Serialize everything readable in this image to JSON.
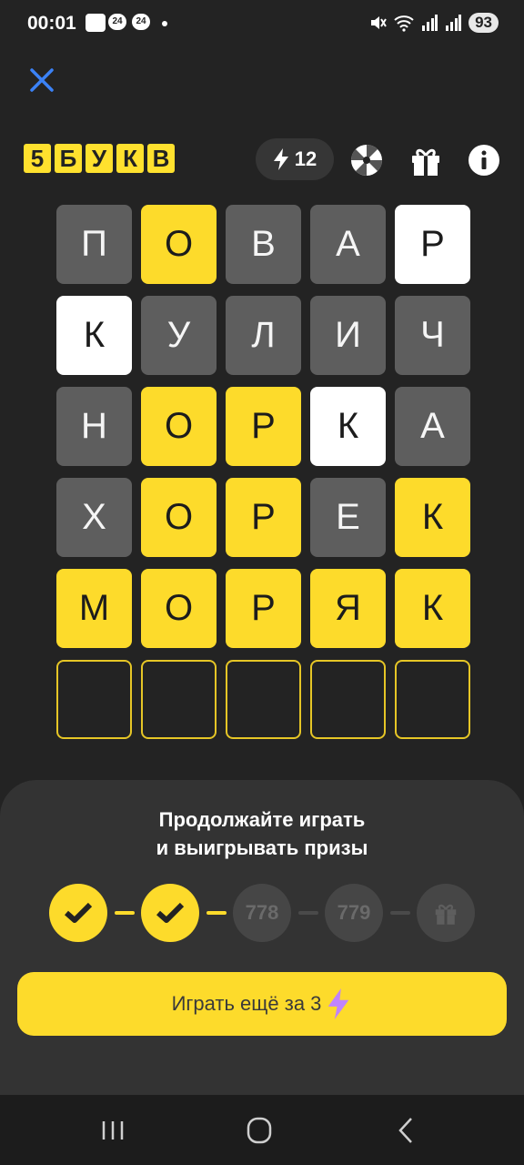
{
  "status_bar": {
    "time": "00:01",
    "notif_1": "24",
    "notif_2": "24",
    "battery": "93"
  },
  "header": {
    "logo_letters": [
      "5",
      "Б",
      "У",
      "К",
      "В"
    ],
    "energy_count": "12"
  },
  "grid": {
    "rows": [
      [
        {
          "l": "П",
          "s": "gray"
        },
        {
          "l": "О",
          "s": "yellow"
        },
        {
          "l": "В",
          "s": "gray"
        },
        {
          "l": "А",
          "s": "gray"
        },
        {
          "l": "Р",
          "s": "white"
        }
      ],
      [
        {
          "l": "К",
          "s": "white"
        },
        {
          "l": "У",
          "s": "gray"
        },
        {
          "l": "Л",
          "s": "gray"
        },
        {
          "l": "И",
          "s": "gray"
        },
        {
          "l": "Ч",
          "s": "gray"
        }
      ],
      [
        {
          "l": "Н",
          "s": "gray"
        },
        {
          "l": "О",
          "s": "yellow"
        },
        {
          "l": "Р",
          "s": "yellow"
        },
        {
          "l": "К",
          "s": "white"
        },
        {
          "l": "А",
          "s": "gray"
        }
      ],
      [
        {
          "l": "Х",
          "s": "gray"
        },
        {
          "l": "О",
          "s": "yellow"
        },
        {
          "l": "Р",
          "s": "yellow"
        },
        {
          "l": "Е",
          "s": "gray"
        },
        {
          "l": "К",
          "s": "yellow"
        }
      ],
      [
        {
          "l": "М",
          "s": "yellow"
        },
        {
          "l": "О",
          "s": "yellow"
        },
        {
          "l": "Р",
          "s": "yellow"
        },
        {
          "l": "Я",
          "s": "yellow"
        },
        {
          "l": "К",
          "s": "yellow"
        }
      ],
      [
        {
          "l": "",
          "s": "empty"
        },
        {
          "l": "",
          "s": "empty"
        },
        {
          "l": "",
          "s": "empty"
        },
        {
          "l": "",
          "s": "empty"
        },
        {
          "l": "",
          "s": "empty"
        }
      ]
    ]
  },
  "sheet": {
    "title_line1": "Продолжайте играть",
    "title_line2": "и выигрывать призы",
    "progress": {
      "step3": "778",
      "step4": "779"
    },
    "play_button": "Играть ещё за 3"
  },
  "colors": {
    "accent": "#fddb2b",
    "tile_gray": "#5e5e5e",
    "background": "#232323"
  }
}
